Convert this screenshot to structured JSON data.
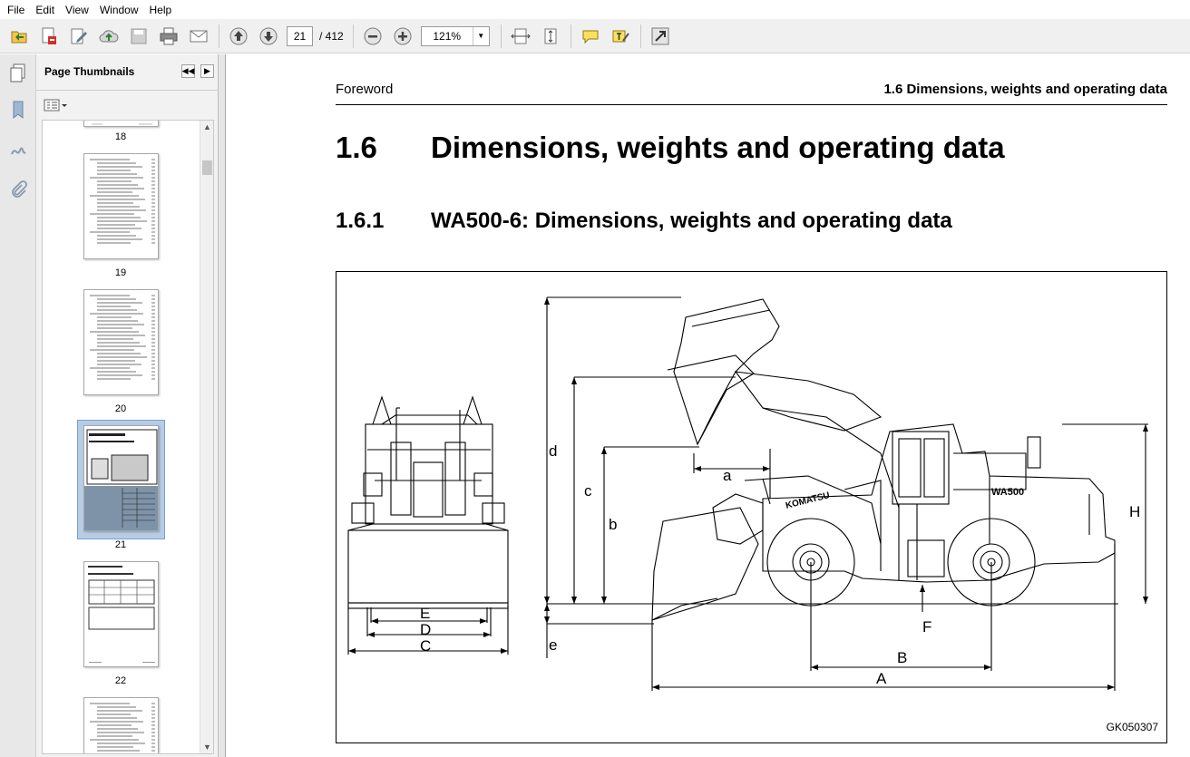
{
  "menu": [
    "File",
    "Edit",
    "View",
    "Window",
    "Help"
  ],
  "toolbar": {
    "current_page": "21",
    "page_count": "/ 412",
    "zoom": "121%"
  },
  "thumbnails_panel": {
    "title": "Page Thumbnails",
    "pages": [
      "18",
      "19",
      "20",
      "21",
      "22"
    ],
    "selected_page": "21"
  },
  "document": {
    "running_head_left": "Foreword",
    "running_head_right": "1.6  Dimensions, weights and operating data",
    "section_number": "1.6",
    "section_title": "Dimensions, weights and operating data",
    "subsection_number": "1.6.1",
    "subsection_title": "WA500-6: Dimensions, weights and operating data",
    "figure": {
      "code": "GK050307",
      "labels": {
        "a": "a",
        "b": "b",
        "c": "c",
        "d": "d",
        "e": "e",
        "A": "A",
        "B": "B",
        "C": "C",
        "D": "D",
        "E": "E",
        "F": "F",
        "H": "H",
        "model": "WA500",
        "brand": "KOMATSU"
      }
    }
  }
}
